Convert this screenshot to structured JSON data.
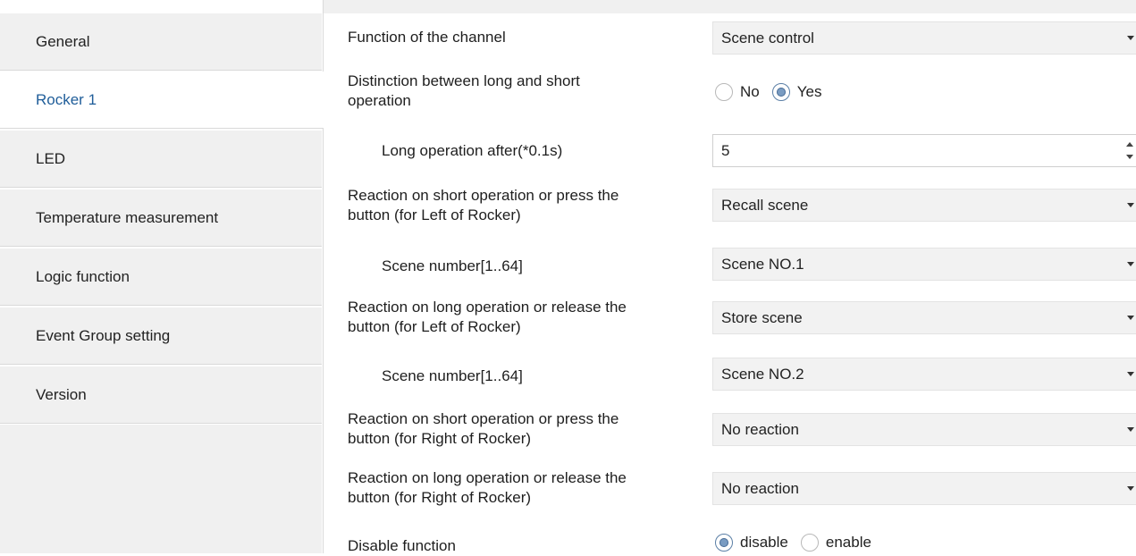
{
  "sidebar": {
    "items": [
      {
        "label": "General"
      },
      {
        "label": "Rocker 1"
      },
      {
        "label": "LED"
      },
      {
        "label": "Temperature measurement"
      },
      {
        "label": "Logic function"
      },
      {
        "label": "Event Group setting"
      },
      {
        "label": "Version"
      }
    ],
    "active_index": 1,
    "active_color": "#1f5d99"
  },
  "params": {
    "function_of_channel": {
      "label": "Function of the channel",
      "value": "Scene control"
    },
    "distinction": {
      "label_line1": "Distinction between long and short",
      "label_line2": "operation",
      "options": [
        "No",
        "Yes"
      ],
      "selected": "Yes"
    },
    "long_operation_after": {
      "label": "Long operation after(*0.1s)",
      "value": "5"
    },
    "short_left": {
      "label_line1": "Reaction on short operation or press the",
      "label_line2": "button (for Left of Rocker)",
      "value": "Recall scene"
    },
    "scene_left_short": {
      "label": "Scene number[1..64]",
      "value": "Scene NO.1"
    },
    "long_left": {
      "label_line1": "Reaction on long operation or release the",
      "label_line2": "button (for Left of Rocker)",
      "value": "Store scene"
    },
    "scene_left_long": {
      "label": "Scene number[1..64]",
      "value": "Scene NO.2"
    },
    "short_right": {
      "label_line1": "Reaction on short operation or press the",
      "label_line2": "button (for Right of Rocker)",
      "value": "No reaction"
    },
    "long_right": {
      "label_line1": "Reaction on long operation or release the",
      "label_line2": "button (for Right of Rocker)",
      "value": "No reaction"
    },
    "disable_function": {
      "label": "Disable function",
      "options": [
        "disable",
        "enable"
      ],
      "selected": "disable"
    }
  }
}
